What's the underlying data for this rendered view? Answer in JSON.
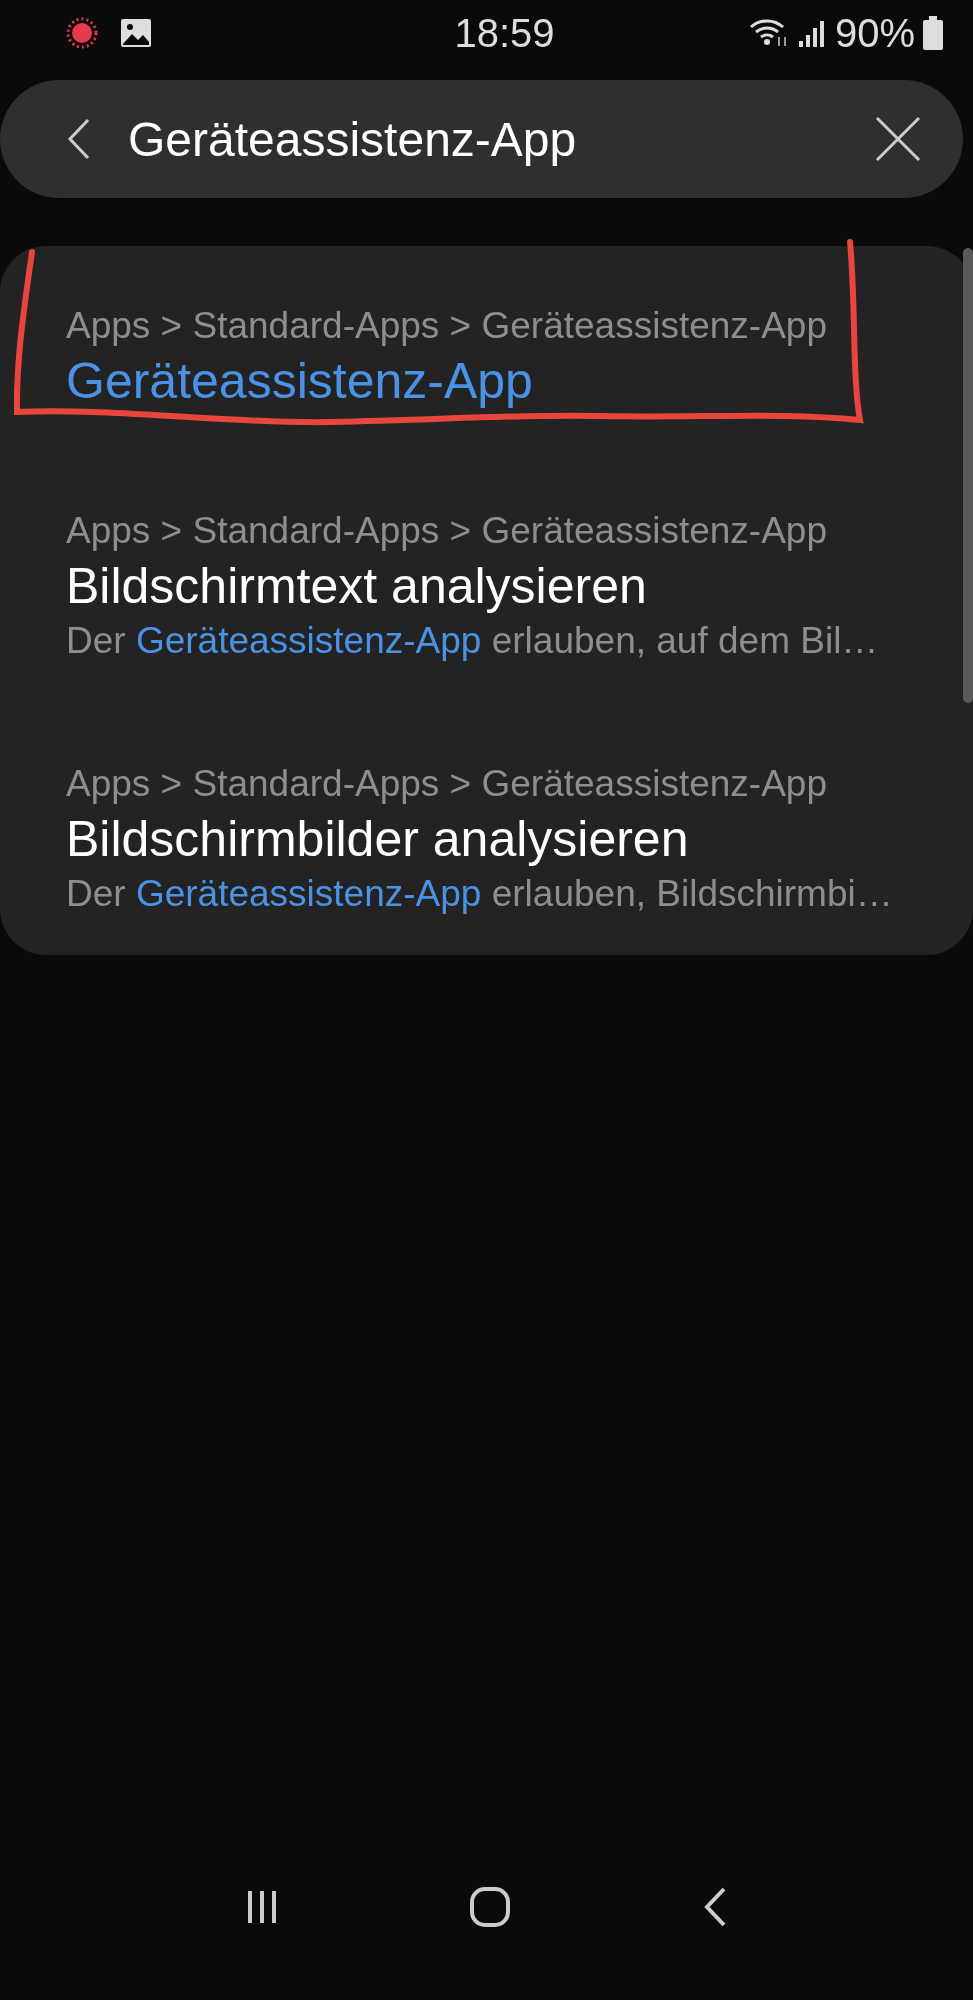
{
  "status_bar": {
    "time": "18:59",
    "battery": "90%"
  },
  "search": {
    "value": "Geräteassistenz-App"
  },
  "red_annotation": true,
  "results": [
    {
      "path": "Apps > Standard-Apps > Geräteassistenz-App",
      "title": "Geräteassistenz-App",
      "title_highlighted": true
    },
    {
      "path": "Apps > Standard-Apps > Geräteassistenz-App",
      "title": "Bildschirmtext analysieren",
      "title_highlighted": false,
      "summary": [
        {
          "text": "Der ",
          "highlighted": false
        },
        {
          "text": "Geräteassistenz-App",
          "highlighted": true
        },
        {
          "text": " erlauben, auf dem Bil…",
          "highlighted": false
        }
      ]
    },
    {
      "path": "Apps > Standard-Apps > Geräteassistenz-App",
      "title": "Bildschirmbilder analysieren",
      "title_highlighted": false,
      "summary": [
        {
          "text": "Der ",
          "highlighted": false
        },
        {
          "text": "Geräteassistenz-App",
          "highlighted": true
        },
        {
          "text": " erlauben, Bildschirmbi…",
          "highlighted": false
        }
      ]
    }
  ]
}
